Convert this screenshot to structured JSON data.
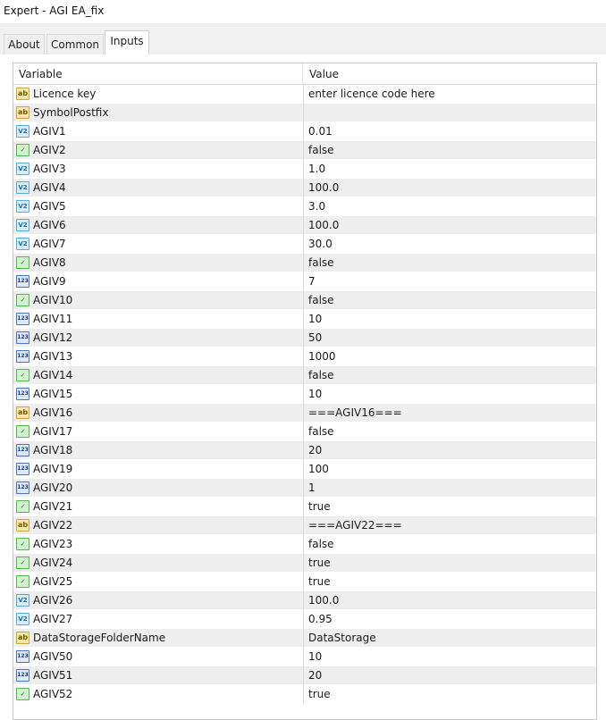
{
  "window": {
    "title": "Expert - AGI EA_fix"
  },
  "tabs": [
    {
      "label": "About",
      "active": false
    },
    {
      "label": "Common",
      "active": false
    },
    {
      "label": "Inputs",
      "active": true
    }
  ],
  "grid": {
    "columns": {
      "variable": "Variable",
      "value": "Value"
    },
    "type_icons": {
      "string": "ab",
      "double": "V2",
      "bool": "✓",
      "int": "123"
    },
    "rows": [
      {
        "type": "string",
        "name": "Licence key",
        "value": "enter licence code here"
      },
      {
        "type": "string",
        "name": "SymbolPostfix",
        "value": ""
      },
      {
        "type": "double",
        "name": "AGIV1",
        "value": "0.01"
      },
      {
        "type": "bool",
        "name": "AGIV2",
        "value": "false"
      },
      {
        "type": "double",
        "name": "AGIV3",
        "value": "1.0"
      },
      {
        "type": "double",
        "name": "AGIV4",
        "value": "100.0"
      },
      {
        "type": "double",
        "name": "AGIV5",
        "value": "3.0"
      },
      {
        "type": "double",
        "name": "AGIV6",
        "value": "100.0"
      },
      {
        "type": "double",
        "name": "AGIV7",
        "value": "30.0"
      },
      {
        "type": "bool",
        "name": "AGIV8",
        "value": "false"
      },
      {
        "type": "int",
        "name": "AGIV9",
        "value": "7"
      },
      {
        "type": "bool",
        "name": "AGIV10",
        "value": "false"
      },
      {
        "type": "int",
        "name": "AGIV11",
        "value": "10"
      },
      {
        "type": "int",
        "name": "AGIV12",
        "value": "50"
      },
      {
        "type": "int",
        "name": "AGIV13",
        "value": "1000"
      },
      {
        "type": "bool",
        "name": "AGIV14",
        "value": "false"
      },
      {
        "type": "int",
        "name": "AGIV15",
        "value": "10"
      },
      {
        "type": "string",
        "name": "AGIV16",
        "value": "===AGIV16==="
      },
      {
        "type": "bool",
        "name": "AGIV17",
        "value": "false"
      },
      {
        "type": "int",
        "name": "AGIV18",
        "value": "20"
      },
      {
        "type": "int",
        "name": "AGIV19",
        "value": "100"
      },
      {
        "type": "int",
        "name": "AGIV20",
        "value": "1"
      },
      {
        "type": "bool",
        "name": "AGIV21",
        "value": "true"
      },
      {
        "type": "string",
        "name": "AGIV22",
        "value": "===AGIV22==="
      },
      {
        "type": "bool",
        "name": "AGIV23",
        "value": "false"
      },
      {
        "type": "bool",
        "name": "AGIV24",
        "value": "true"
      },
      {
        "type": "bool",
        "name": "AGIV25",
        "value": "true"
      },
      {
        "type": "double",
        "name": "AGIV26",
        "value": "100.0"
      },
      {
        "type": "double",
        "name": "AGIV27",
        "value": "0.95"
      },
      {
        "type": "string",
        "name": "DataStorageFolderName",
        "value": "DataStorage"
      },
      {
        "type": "int",
        "name": "AGIV50",
        "value": "10"
      },
      {
        "type": "int",
        "name": "AGIV51",
        "value": "20"
      },
      {
        "type": "bool",
        "name": "AGIV52",
        "value": "true"
      }
    ]
  }
}
